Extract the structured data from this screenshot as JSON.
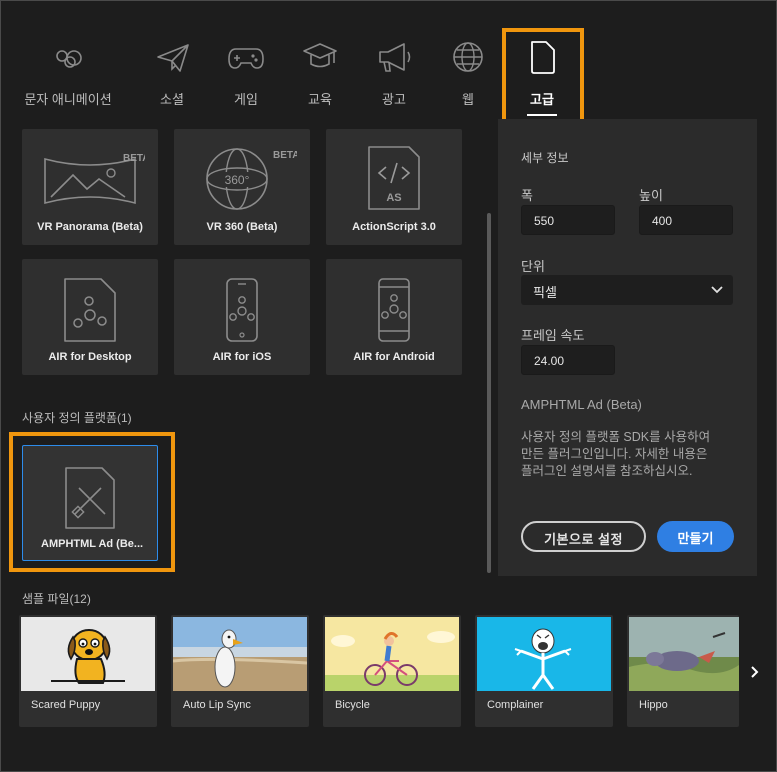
{
  "tabs": [
    {
      "label": "문자 애니메이션",
      "icon": "character-animation-icon"
    },
    {
      "label": "소셜",
      "icon": "paper-plane-icon"
    },
    {
      "label": "게임",
      "icon": "gamepad-icon"
    },
    {
      "label": "교육",
      "icon": "graduation-cap-icon"
    },
    {
      "label": "광고",
      "icon": "megaphone-icon"
    },
    {
      "label": "웹",
      "icon": "globe-icon"
    },
    {
      "label": "고급",
      "icon": "document-icon",
      "active": true
    }
  ],
  "templates": [
    {
      "name": "VR Panorama (Beta)",
      "badge": "BETA",
      "icon": "panorama-icon"
    },
    {
      "name": "VR 360 (Beta)",
      "badge": "BETA",
      "icon": "vr-360-icon",
      "center_text": "360°"
    },
    {
      "name": "ActionScript 3.0",
      "icon": "actionscript-file-icon",
      "file_tag": "AS"
    },
    {
      "name": "AIR for Desktop",
      "icon": "air-desktop-icon"
    },
    {
      "name": "AIR for iOS",
      "icon": "air-ios-icon"
    },
    {
      "name": "AIR for Android",
      "icon": "air-android-icon"
    }
  ],
  "custom_platforms": {
    "heading": "사용자 정의 플랫폼(1)",
    "items": [
      {
        "name": "AMPHTML Ad (Be...",
        "icon": "amphtml-file-icon",
        "selected": true
      }
    ]
  },
  "details": {
    "heading": "세부 정보",
    "width_label": "폭",
    "width_value": "550",
    "height_label": "높이",
    "height_value": "400",
    "units_label": "단위",
    "units_value": "픽셀",
    "fps_label": "프레임 속도",
    "fps_value": "24.00",
    "platform_name": "AMPHTML Ad (Beta)",
    "description_lines": [
      "사용자 정의 플랫폼 SDK를 사용하여",
      "만든 플러그인입니다. 자세한 내용은",
      "플러그인 설명서를 참조하십시오."
    ],
    "set_default_label": "기본으로 설정",
    "create_label": "만들기"
  },
  "samples": {
    "heading": "샘플 파일(12)",
    "items": [
      {
        "name": "Scared Puppy"
      },
      {
        "name": "Auto Lip Sync"
      },
      {
        "name": "Bicycle"
      },
      {
        "name": "Complainer"
      },
      {
        "name": "Hippo"
      }
    ]
  },
  "colors": {
    "accent_blue": "#2f7fe3",
    "highlight_orange": "#f0960e",
    "background": "#1d1d1d",
    "panel": "#2b2b2b"
  }
}
